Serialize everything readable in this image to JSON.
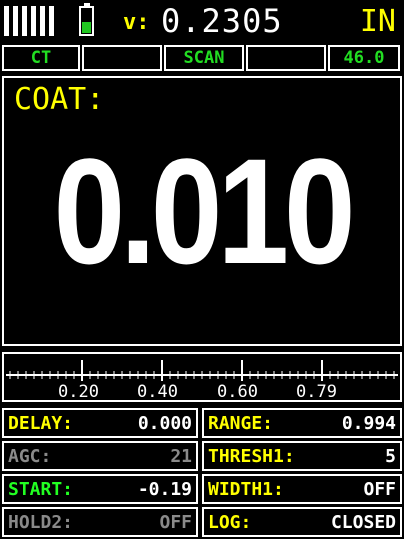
{
  "header": {
    "velocity_label": "v:",
    "velocity_value": "0.2305",
    "units": "IN",
    "battery_icon": "battery-level-icon",
    "battery_fill_fraction": 0.4,
    "battery_fill_color": "#22c722"
  },
  "status": {
    "mode": "CT",
    "blank1": "",
    "scan": "SCAN",
    "blank2": "",
    "gain": "46.0"
  },
  "reading": {
    "label": "COAT:",
    "value": "0.010"
  },
  "scale": {
    "labels": [
      "0.20",
      "0.40",
      "0.60",
      "0.79"
    ]
  },
  "params": {
    "left": [
      {
        "label": "DELAY:",
        "value": "0.000",
        "state": "normal"
      },
      {
        "label": "AGC:",
        "value": "21",
        "state": "dim"
      },
      {
        "label": "START:",
        "value": "-0.19",
        "state": "selected"
      },
      {
        "label": "HOLD2:",
        "value": "OFF",
        "state": "dim"
      }
    ],
    "right": [
      {
        "label": "RANGE:",
        "value": "0.994",
        "state": "normal"
      },
      {
        "label": "THRESH1:",
        "value": "5",
        "state": "normal"
      },
      {
        "label": "WIDTH1:",
        "value": "OFF",
        "state": "normal"
      },
      {
        "label": "LOG:",
        "value": "CLOSED",
        "state": "normal"
      }
    ]
  },
  "colors": {
    "label": "#ffff00",
    "value": "#ffffff",
    "status_text": "#22dd22",
    "selected_label": "#22ff22",
    "dim": "#8a8a8a"
  }
}
